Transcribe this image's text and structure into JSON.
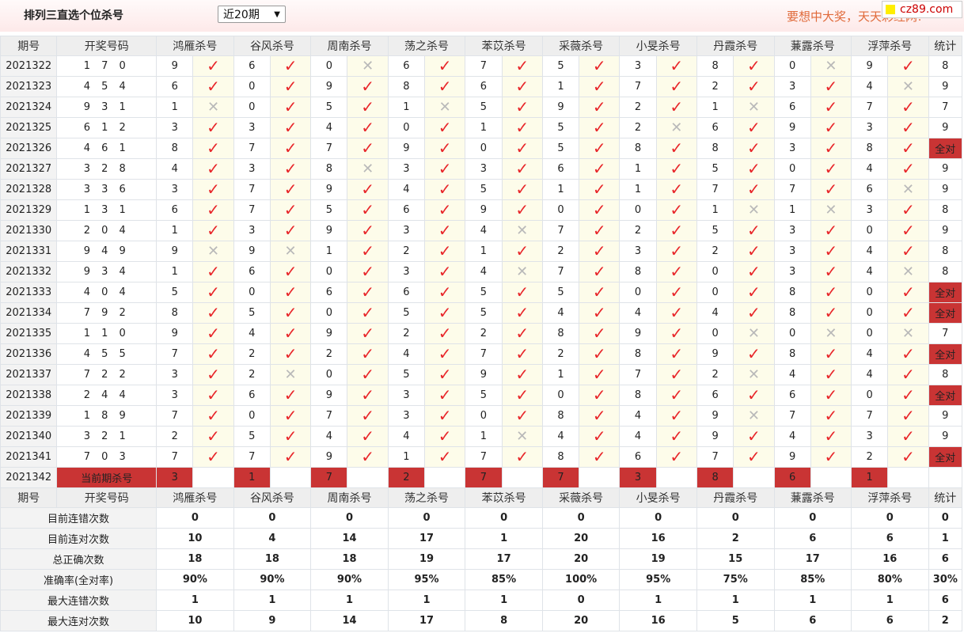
{
  "header": {
    "title": "排列三直选个位杀号",
    "period_select": "近20期",
    "slogan": "要想中大奖，天天彩经网!",
    "logo": "cz89.com"
  },
  "columns": {
    "period": "期号",
    "open": "开奖号码",
    "killers": [
      "鸿雁杀号",
      "谷风杀号",
      "周南杀号",
      "荡之杀号",
      "苯苡杀号",
      "采薇杀号",
      "小旻杀号",
      "丹霞杀号",
      "蒹露杀号",
      "浮萍杀号"
    ],
    "stat": "统计"
  },
  "rows": [
    {
      "period": "2021322",
      "open": "1 7 0",
      "k": [
        [
          9,
          1
        ],
        [
          6,
          1
        ],
        [
          0,
          0
        ],
        [
          6,
          1
        ],
        [
          7,
          1
        ],
        [
          5,
          1
        ],
        [
          3,
          1
        ],
        [
          8,
          1
        ],
        [
          0,
          0
        ],
        [
          9,
          1
        ]
      ],
      "stat": "8"
    },
    {
      "period": "2021323",
      "open": "4 5 4",
      "k": [
        [
          6,
          1
        ],
        [
          0,
          1
        ],
        [
          9,
          1
        ],
        [
          8,
          1
        ],
        [
          6,
          1
        ],
        [
          1,
          1
        ],
        [
          7,
          1
        ],
        [
          2,
          1
        ],
        [
          3,
          1
        ],
        [
          4,
          0
        ]
      ],
      "stat": "9"
    },
    {
      "period": "2021324",
      "open": "9 3 1",
      "k": [
        [
          1,
          0
        ],
        [
          0,
          1
        ],
        [
          5,
          1
        ],
        [
          1,
          0
        ],
        [
          5,
          1
        ],
        [
          9,
          1
        ],
        [
          2,
          1
        ],
        [
          1,
          0
        ],
        [
          6,
          1
        ],
        [
          7,
          1
        ]
      ],
      "stat": "7"
    },
    {
      "period": "2021325",
      "open": "6 1 2",
      "k": [
        [
          3,
          1
        ],
        [
          3,
          1
        ],
        [
          4,
          1
        ],
        [
          0,
          1
        ],
        [
          1,
          1
        ],
        [
          5,
          1
        ],
        [
          2,
          0
        ],
        [
          6,
          1
        ],
        [
          9,
          1
        ],
        [
          3,
          1
        ]
      ],
      "stat": "9"
    },
    {
      "period": "2021326",
      "open": "4 6 1",
      "k": [
        [
          8,
          1
        ],
        [
          7,
          1
        ],
        [
          7,
          1
        ],
        [
          9,
          1
        ],
        [
          0,
          1
        ],
        [
          5,
          1
        ],
        [
          8,
          1
        ],
        [
          8,
          1
        ],
        [
          3,
          1
        ],
        [
          8,
          1
        ]
      ],
      "stat": "全对"
    },
    {
      "period": "2021327",
      "open": "3 2 8",
      "k": [
        [
          4,
          1
        ],
        [
          3,
          1
        ],
        [
          8,
          0
        ],
        [
          3,
          1
        ],
        [
          3,
          1
        ],
        [
          6,
          1
        ],
        [
          1,
          1
        ],
        [
          5,
          1
        ],
        [
          0,
          1
        ],
        [
          4,
          1
        ]
      ],
      "stat": "9"
    },
    {
      "period": "2021328",
      "open": "3 3 6",
      "k": [
        [
          3,
          1
        ],
        [
          7,
          1
        ],
        [
          9,
          1
        ],
        [
          4,
          1
        ],
        [
          5,
          1
        ],
        [
          1,
          1
        ],
        [
          1,
          1
        ],
        [
          7,
          1
        ],
        [
          7,
          1
        ],
        [
          6,
          0
        ]
      ],
      "stat": "9"
    },
    {
      "period": "2021329",
      "open": "1 3 1",
      "k": [
        [
          6,
          1
        ],
        [
          7,
          1
        ],
        [
          5,
          1
        ],
        [
          6,
          1
        ],
        [
          9,
          1
        ],
        [
          0,
          1
        ],
        [
          0,
          1
        ],
        [
          1,
          0
        ],
        [
          1,
          0
        ],
        [
          3,
          1
        ]
      ],
      "stat": "8"
    },
    {
      "period": "2021330",
      "open": "2 0 4",
      "k": [
        [
          1,
          1
        ],
        [
          3,
          1
        ],
        [
          9,
          1
        ],
        [
          3,
          1
        ],
        [
          4,
          0
        ],
        [
          7,
          1
        ],
        [
          2,
          1
        ],
        [
          5,
          1
        ],
        [
          3,
          1
        ],
        [
          0,
          1
        ]
      ],
      "stat": "9"
    },
    {
      "period": "2021331",
      "open": "9 4 9",
      "k": [
        [
          9,
          0
        ],
        [
          9,
          0
        ],
        [
          1,
          1
        ],
        [
          2,
          1
        ],
        [
          1,
          1
        ],
        [
          2,
          1
        ],
        [
          3,
          1
        ],
        [
          2,
          1
        ],
        [
          3,
          1
        ],
        [
          4,
          1
        ]
      ],
      "stat": "8"
    },
    {
      "period": "2021332",
      "open": "9 3 4",
      "k": [
        [
          1,
          1
        ],
        [
          6,
          1
        ],
        [
          0,
          1
        ],
        [
          3,
          1
        ],
        [
          4,
          0
        ],
        [
          7,
          1
        ],
        [
          8,
          1
        ],
        [
          0,
          1
        ],
        [
          3,
          1
        ],
        [
          4,
          0
        ]
      ],
      "stat": "8"
    },
    {
      "period": "2021333",
      "open": "4 0 4",
      "k": [
        [
          5,
          1
        ],
        [
          0,
          1
        ],
        [
          6,
          1
        ],
        [
          6,
          1
        ],
        [
          5,
          1
        ],
        [
          5,
          1
        ],
        [
          0,
          1
        ],
        [
          0,
          1
        ],
        [
          8,
          1
        ],
        [
          0,
          1
        ]
      ],
      "stat": "全对"
    },
    {
      "period": "2021334",
      "open": "7 9 2",
      "k": [
        [
          8,
          1
        ],
        [
          5,
          1
        ],
        [
          0,
          1
        ],
        [
          5,
          1
        ],
        [
          5,
          1
        ],
        [
          4,
          1
        ],
        [
          4,
          1
        ],
        [
          4,
          1
        ],
        [
          8,
          1
        ],
        [
          0,
          1
        ]
      ],
      "stat": "全对"
    },
    {
      "period": "2021335",
      "open": "1 1 0",
      "k": [
        [
          9,
          1
        ],
        [
          4,
          1
        ],
        [
          9,
          1
        ],
        [
          2,
          1
        ],
        [
          2,
          1
        ],
        [
          8,
          1
        ],
        [
          9,
          1
        ],
        [
          0,
          0
        ],
        [
          0,
          0
        ],
        [
          0,
          0
        ]
      ],
      "stat": "7"
    },
    {
      "period": "2021336",
      "open": "4 5 5",
      "k": [
        [
          7,
          1
        ],
        [
          2,
          1
        ],
        [
          2,
          1
        ],
        [
          4,
          1
        ],
        [
          7,
          1
        ],
        [
          2,
          1
        ],
        [
          8,
          1
        ],
        [
          9,
          1
        ],
        [
          8,
          1
        ],
        [
          4,
          1
        ]
      ],
      "stat": "全对"
    },
    {
      "period": "2021337",
      "open": "7 2 2",
      "k": [
        [
          3,
          1
        ],
        [
          2,
          0
        ],
        [
          0,
          1
        ],
        [
          5,
          1
        ],
        [
          9,
          1
        ],
        [
          1,
          1
        ],
        [
          7,
          1
        ],
        [
          2,
          0
        ],
        [
          4,
          1
        ],
        [
          4,
          1
        ]
      ],
      "stat": "8"
    },
    {
      "period": "2021338",
      "open": "2 4 4",
      "k": [
        [
          3,
          1
        ],
        [
          6,
          1
        ],
        [
          9,
          1
        ],
        [
          3,
          1
        ],
        [
          5,
          1
        ],
        [
          0,
          1
        ],
        [
          8,
          1
        ],
        [
          6,
          1
        ],
        [
          6,
          1
        ],
        [
          0,
          1
        ]
      ],
      "stat": "全对"
    },
    {
      "period": "2021339",
      "open": "1 8 9",
      "k": [
        [
          7,
          1
        ],
        [
          0,
          1
        ],
        [
          7,
          1
        ],
        [
          3,
          1
        ],
        [
          0,
          1
        ],
        [
          8,
          1
        ],
        [
          4,
          1
        ],
        [
          9,
          0
        ],
        [
          7,
          1
        ],
        [
          7,
          1
        ]
      ],
      "stat": "9"
    },
    {
      "period": "2021340",
      "open": "3 2 1",
      "k": [
        [
          2,
          1
        ],
        [
          5,
          1
        ],
        [
          4,
          1
        ],
        [
          4,
          1
        ],
        [
          1,
          0
        ],
        [
          4,
          1
        ],
        [
          4,
          1
        ],
        [
          9,
          1
        ],
        [
          4,
          1
        ],
        [
          3,
          1
        ]
      ],
      "stat": "9"
    },
    {
      "period": "2021341",
      "open": "7 0 3",
      "k": [
        [
          7,
          1
        ],
        [
          7,
          1
        ],
        [
          9,
          1
        ],
        [
          1,
          1
        ],
        [
          7,
          1
        ],
        [
          8,
          1
        ],
        [
          6,
          1
        ],
        [
          7,
          1
        ],
        [
          9,
          1
        ],
        [
          2,
          1
        ]
      ],
      "stat": "全对"
    }
  ],
  "current": {
    "period": "2021342",
    "label": "当前期杀号",
    "values": [
      "3",
      "1",
      "7",
      "2",
      "7",
      "7",
      "3",
      "8",
      "6",
      "1"
    ]
  },
  "stats": [
    {
      "label": "目前连错次数",
      "values": [
        "0",
        "0",
        "0",
        "0",
        "0",
        "0",
        "0",
        "0",
        "0",
        "0"
      ],
      "total": "0",
      "cls": "blue"
    },
    {
      "label": "目前连对次数",
      "values": [
        "10",
        "4",
        "14",
        "17",
        "1",
        "20",
        "16",
        "2",
        "6",
        "6"
      ],
      "total": "1",
      "cls": "blue"
    },
    {
      "label": "总正确次数",
      "values": [
        "18",
        "18",
        "18",
        "19",
        "17",
        "20",
        "19",
        "15",
        "17",
        "16"
      ],
      "total": "6",
      "cls": "blue"
    },
    {
      "label": "准确率(全对率)",
      "values": [
        "90%",
        "90%",
        "90%",
        "95%",
        "85%",
        "100%",
        "95%",
        "75%",
        "85%",
        "80%"
      ],
      "total": "30%",
      "cls": "red"
    },
    {
      "label": "最大连错次数",
      "values": [
        "1",
        "1",
        "1",
        "1",
        "1",
        "0",
        "1",
        "1",
        "1",
        "1"
      ],
      "total": "6",
      "cls": "blue"
    },
    {
      "label": "最大连对次数",
      "values": [
        "10",
        "9",
        "14",
        "17",
        "8",
        "20",
        "16",
        "5",
        "6",
        "6"
      ],
      "total": "2",
      "cls": "blue"
    }
  ],
  "marks": {
    "ok": "✓",
    "bad": "✕"
  },
  "colors": {
    "accent_red": "#c93434",
    "check_red": "#e8262a",
    "stat_blue": "#1b3aa8"
  }
}
